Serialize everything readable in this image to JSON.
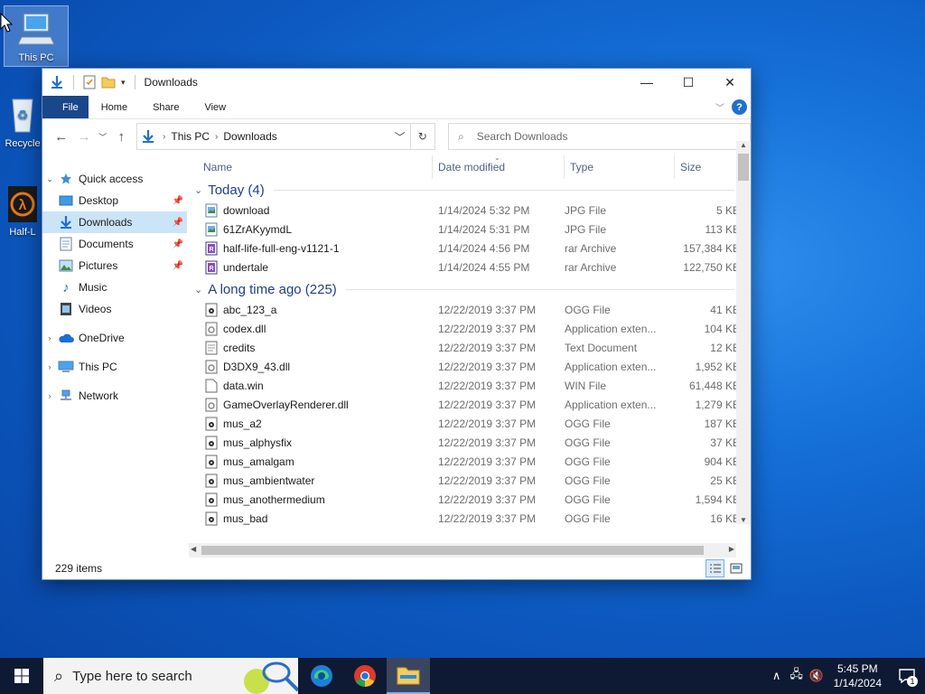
{
  "desktop": {
    "icons": [
      {
        "label": "This PC"
      },
      {
        "label": "Recycle"
      },
      {
        "label": "Half-L"
      }
    ]
  },
  "window": {
    "title": "Downloads",
    "ribbon": {
      "tabs": [
        "File",
        "Home",
        "Share",
        "View"
      ]
    },
    "address": {
      "crumbs": [
        "This PC",
        "Downloads"
      ]
    },
    "search": {
      "placeholder": "Search Downloads"
    },
    "sidebar": {
      "quick_access": "Quick access",
      "items": [
        "Desktop",
        "Downloads",
        "Documents",
        "Pictures",
        "Music",
        "Videos"
      ],
      "onedrive": "OneDrive",
      "thispc": "This PC",
      "network": "Network"
    },
    "columns": [
      "Name",
      "Date modified",
      "Type",
      "Size"
    ],
    "groups": [
      {
        "label": "Today (4)",
        "files": [
          {
            "name": "download",
            "date": "1/14/2024 5:32 PM",
            "type": "JPG File",
            "size": "5 KB",
            "icon": "image-file-icon"
          },
          {
            "name": "61ZrAKyymdL",
            "date": "1/14/2024 5:31 PM",
            "type": "JPG File",
            "size": "113 KB",
            "icon": "image-file-icon"
          },
          {
            "name": "half-life-full-eng-v1121-1",
            "date": "1/14/2024 4:56 PM",
            "type": "rar Archive",
            "size": "157,384 KB",
            "icon": "rar-archive-icon"
          },
          {
            "name": "undertale",
            "date": "1/14/2024 4:55 PM",
            "type": "rar Archive",
            "size": "122,750 KB",
            "icon": "rar-archive-icon"
          }
        ]
      },
      {
        "label": "A long time ago (225)",
        "files": [
          {
            "name": "abc_123_a",
            "date": "12/22/2019 3:37 PM",
            "type": "OGG File",
            "size": "41 KB",
            "icon": "audio-file-icon"
          },
          {
            "name": "codex.dll",
            "date": "12/22/2019 3:37 PM",
            "type": "Application exten...",
            "size": "104 KB",
            "icon": "dll-file-icon"
          },
          {
            "name": "credits",
            "date": "12/22/2019 3:37 PM",
            "type": "Text Document",
            "size": "12 KB",
            "icon": "text-file-icon"
          },
          {
            "name": "D3DX9_43.dll",
            "date": "12/22/2019 3:37 PM",
            "type": "Application exten...",
            "size": "1,952 KB",
            "icon": "dll-file-icon"
          },
          {
            "name": "data.win",
            "date": "12/22/2019 3:37 PM",
            "type": "WIN File",
            "size": "61,448 KB",
            "icon": "blank-file-icon"
          },
          {
            "name": "GameOverlayRenderer.dll",
            "date": "12/22/2019 3:37 PM",
            "type": "Application exten...",
            "size": "1,279 KB",
            "icon": "dll-file-icon"
          },
          {
            "name": "mus_a2",
            "date": "12/22/2019 3:37 PM",
            "type": "OGG File",
            "size": "187 KB",
            "icon": "audio-file-icon"
          },
          {
            "name": "mus_alphysfix",
            "date": "12/22/2019 3:37 PM",
            "type": "OGG File",
            "size": "37 KB",
            "icon": "audio-file-icon"
          },
          {
            "name": "mus_amalgam",
            "date": "12/22/2019 3:37 PM",
            "type": "OGG File",
            "size": "904 KB",
            "icon": "audio-file-icon"
          },
          {
            "name": "mus_ambientwater",
            "date": "12/22/2019 3:37 PM",
            "type": "OGG File",
            "size": "25 KB",
            "icon": "audio-file-icon"
          },
          {
            "name": "mus_anothermedium",
            "date": "12/22/2019 3:37 PM",
            "type": "OGG File",
            "size": "1,594 KB",
            "icon": "audio-file-icon"
          },
          {
            "name": "mus_bad",
            "date": "12/22/2019 3:37 PM",
            "type": "OGG File",
            "size": "16 KB",
            "icon": "audio-file-icon"
          }
        ]
      }
    ],
    "status": "229 items"
  },
  "taskbar": {
    "search_placeholder": "Type here to search",
    "time": "5:45 PM",
    "date": "1/14/2024",
    "notification_count": "1"
  },
  "colors": {
    "accent": "#19478a",
    "selection": "#cce4f7",
    "group_header": "#1e3f8a",
    "taskbar": "#0e1a33"
  }
}
